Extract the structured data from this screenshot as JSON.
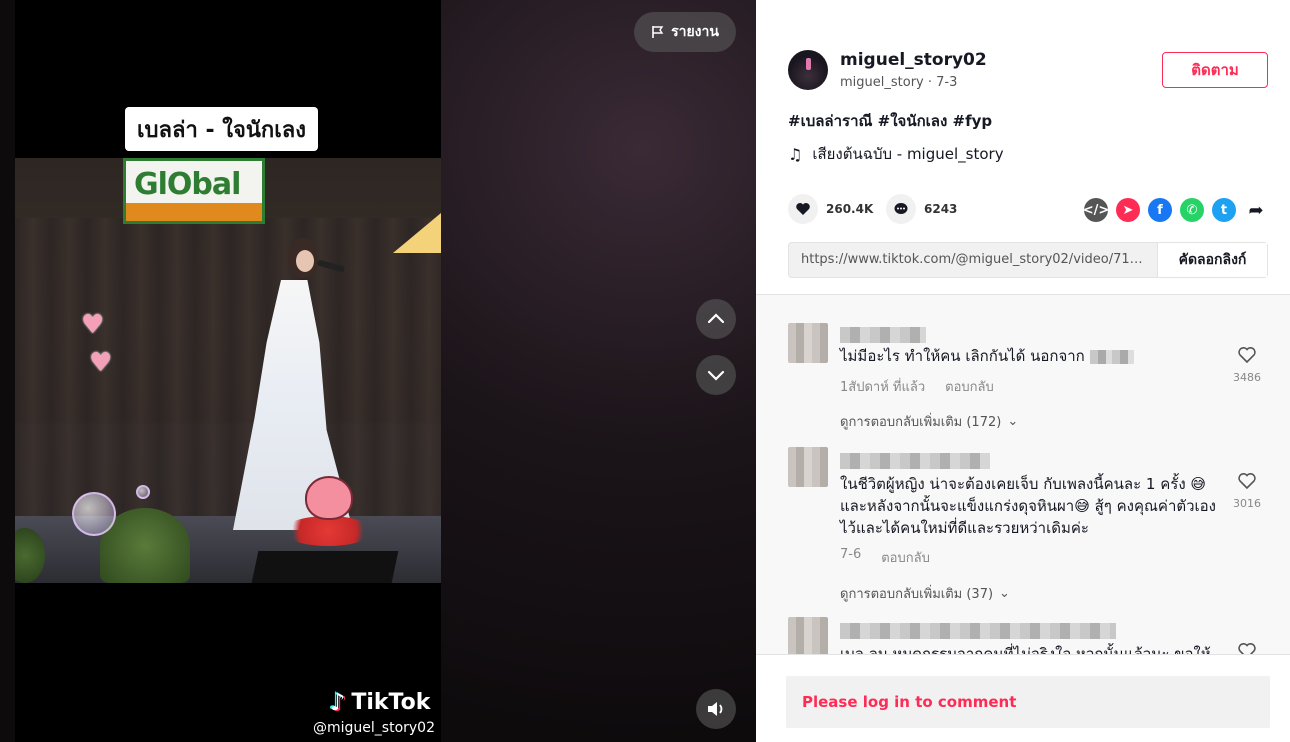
{
  "video": {
    "title_card": "เบลล่า - ใจนักเลง",
    "sign_text": "GlObal",
    "watermark_brand": "TikTok",
    "watermark_user": "@miguel_story02",
    "report_label": "รายงาน"
  },
  "author": {
    "username": "miguel_story02",
    "nickname": "miguel_story",
    "date": "7-3",
    "follow_label": "ติดตาม"
  },
  "post": {
    "caption": "#เบลล่าราณี #ใจนักเลง #fyp",
    "music": "เสียงต้นฉบับ - miguel_story",
    "likes": "260.4K",
    "comments": "6243",
    "link": "https://www.tiktok.com/@miguel_story02/video/71159199...",
    "copy_link_label": "คัดลอกลิงก์"
  },
  "share_icons": [
    "embed-icon",
    "send-icon",
    "facebook-icon",
    "whatsapp-icon",
    "twitter-icon",
    "share-arrow-icon"
  ],
  "comments": [
    {
      "text": "ไม่มีอะไร ทำให้คน เลิกกันได้ นอกจาก",
      "time": "1สัปดาห์ ที่แล้ว",
      "reply_label": "ตอบกลับ",
      "likes": "3486",
      "more_replies": "ดูการตอบกลับเพิ่มเติม (172)"
    },
    {
      "text": "ในชีวิตผู้หญิง น่าจะต้องเคยเจ็บ กับเพลงนี้คนละ 1 ครั้ง 😅 และหลังจากนั้นจะแข็งแกร่งดุจหินผา😅 สู้ๆ คงคุณค่าตัวเองไว้และได้คนใหม่ที่ดีและรวยหว่าเดิมค่ะ",
      "time": "7-6",
      "reply_label": "ตอบกลับ",
      "likes": "3016",
      "more_replies": "ดูการตอบกลับเพิ่มเติม (37)"
    },
    {
      "text": "เบล ลม หมดกรรมจากคนที่ไม่จริงใจ หวกนั้นแล้วนะ ขอให้",
      "likes": ""
    }
  ],
  "login_prompt": "Please log in to comment",
  "colors": {
    "accent": "#fe2c55",
    "text": "#161823"
  }
}
